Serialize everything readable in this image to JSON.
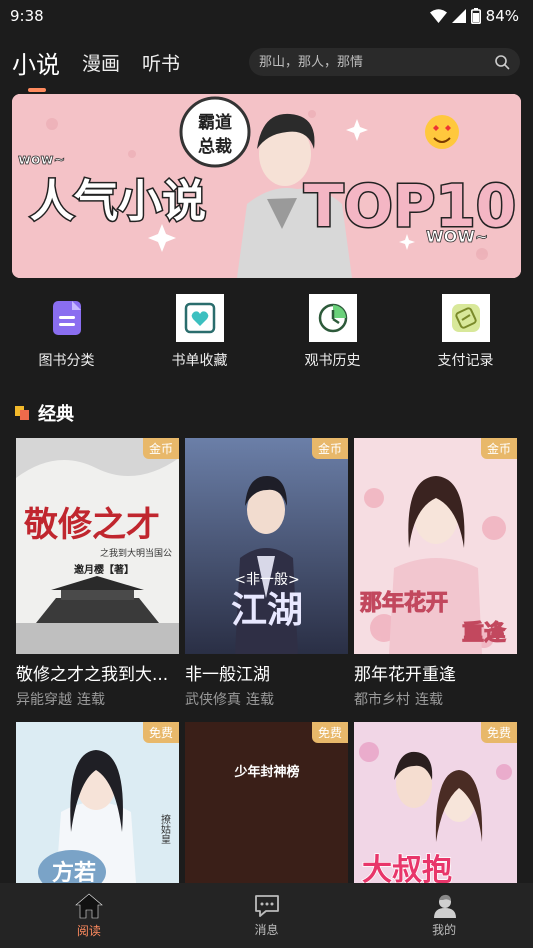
{
  "status": {
    "time": "9:38",
    "battery": "84%"
  },
  "tabs": [
    {
      "label": "小说"
    },
    {
      "label": "漫画"
    },
    {
      "label": "听书"
    }
  ],
  "search": {
    "placeholder": "那山，那人，那情"
  },
  "banner": {
    "tag_top": "霸道",
    "tag_bottom": "总裁",
    "title": "人气小说",
    "rank": "TOP10",
    "wow_left": "wow~",
    "wow_right": "WOW~"
  },
  "quick_actions": [
    {
      "label": "图书分类",
      "icon": "category-icon"
    },
    {
      "label": "书单收藏",
      "icon": "favorite-icon"
    },
    {
      "label": "观书历史",
      "icon": "history-icon"
    },
    {
      "label": "支付记录",
      "icon": "payment-icon"
    }
  ],
  "section": {
    "title": "经典"
  },
  "books": [
    {
      "title": "敬修之才之我到大...",
      "genre": "异能穿越",
      "status": "连载",
      "badge": "金币",
      "cover_text": "敬修之才",
      "cover_sub": "之我到大明当国公",
      "cover_author": "邀月樱【著】"
    },
    {
      "title": "非一般江湖",
      "genre": "武侠修真",
      "status": "连载",
      "badge": "金币",
      "cover_text": "江湖",
      "cover_sub": "<非一般>"
    },
    {
      "title": "那年花开重逢",
      "genre": "都市乡村",
      "status": "连载",
      "badge": "金币",
      "cover_text": "那年花开",
      "cover_sub": "重逢"
    },
    {
      "badge": "免费",
      "cover_text": "方若",
      "cover_side": "撩姑皇"
    },
    {
      "badge": "免费",
      "cover_text": "少年封神榜"
    },
    {
      "badge": "免费",
      "cover_text": "大叔抱"
    }
  ],
  "bottom_nav": [
    {
      "label": "阅读",
      "icon": "home-icon"
    },
    {
      "label": "消息",
      "icon": "message-icon"
    },
    {
      "label": "我的",
      "icon": "profile-icon"
    }
  ],
  "colors": {
    "accent": "#ff8b5f",
    "background": "#1c1c1c",
    "badge": "#e8b86a"
  }
}
